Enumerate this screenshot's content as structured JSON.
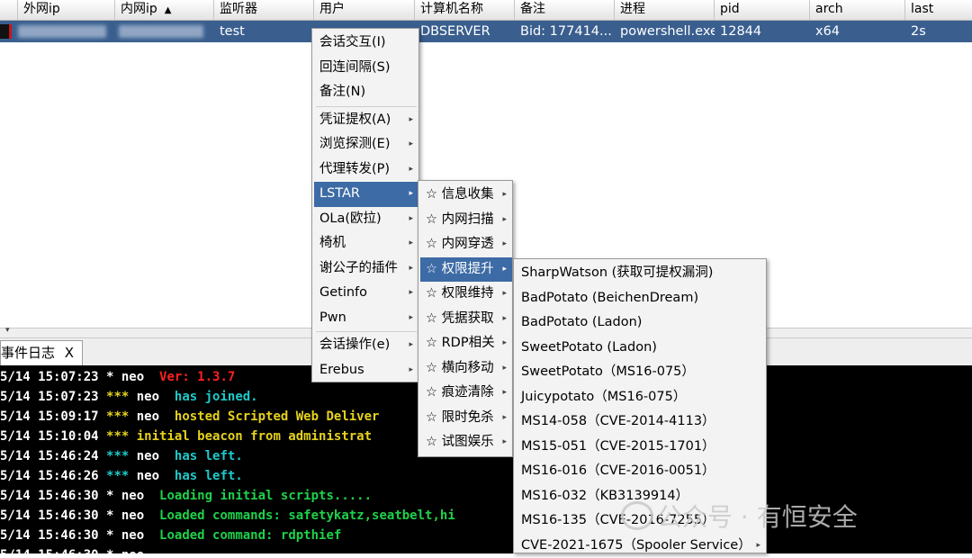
{
  "table": {
    "columns": [
      "外网ip",
      "内网ip",
      "监听器",
      "用户",
      "计算机名称",
      "备注",
      "进程",
      "pid",
      "arch",
      "last"
    ],
    "sort_indicator": "▲",
    "row": {
      "external_ip": "",
      "internal_ip": "",
      "listener": "test",
      "user": "",
      "computer": "DBSERVER",
      "note": "Bid: 177414...",
      "process": "powershell.exe",
      "pid": "12844",
      "arch": "x64",
      "last": "2s"
    }
  },
  "tab": {
    "label": "事件日志",
    "close": "X"
  },
  "console": {
    "lines": [
      {
        "ts": "5/14 15:07:23",
        "mark": "*",
        "user": "neo",
        "msg": "Ver: 1.3.7",
        "mark_color": "#ffffff",
        "msg_color": "#ff2020"
      },
      {
        "ts": "5/14 15:07:23",
        "mark": "***",
        "user": "neo",
        "msg": "has joined.",
        "mark_color": "#e6d21e",
        "msg_color": "#1fc9c9"
      },
      {
        "ts": "5/14 15:09:17",
        "mark": "***",
        "user": "neo",
        "msg": "hosted Scripted Web Deliver",
        "mark_color": "#e6d21e",
        "msg_color": "#e6d21e"
      },
      {
        "ts": "5/14 15:10:04",
        "mark": "***",
        "user": "",
        "msg": "initial beacon from administrat",
        "mark_color": "#e6d21e",
        "msg_color": "#e6d21e"
      },
      {
        "ts": "5/14 15:46:24",
        "mark": "***",
        "user": "neo",
        "msg": "has left.",
        "mark_color": "#1fc9c9",
        "msg_color": "#1fc9c9"
      },
      {
        "ts": "5/14 15:46:26",
        "mark": "***",
        "user": "neo",
        "msg": "has left.",
        "mark_color": "#1fc9c9",
        "msg_color": "#1fc9c9"
      },
      {
        "ts": "5/14 15:46:30",
        "mark": "*",
        "user": "neo",
        "msg": "Loading initial scripts.....",
        "mark_color": "#ffffff",
        "msg_color": "#1fd14a"
      },
      {
        "ts": "5/14 15:46:30",
        "mark": "*",
        "user": "neo",
        "msg": "Loaded commands: safetykatz,seatbelt,hi",
        "mark_color": "#ffffff",
        "msg_color": "#1fd14a"
      },
      {
        "ts": "5/14 15:46:30",
        "mark": "*",
        "user": "neo",
        "msg": "Loaded command: rdpthief",
        "mark_color": "#ffffff",
        "msg_color": "#1fd14a"
      },
      {
        "ts": "5/14 15:46:30",
        "mark": "*",
        "user": "neo",
        "msg": "",
        "mark_color": "#ffffff",
        "msg_color": "#1fd14a"
      }
    ]
  },
  "menu1": {
    "items": [
      {
        "label": "会话交互(I)",
        "sub": false
      },
      {
        "label": "回连间隔(S)",
        "sub": false
      },
      {
        "label": "备注(N)",
        "sub": false
      },
      {
        "label": "凭证提权(A)",
        "sub": true
      },
      {
        "label": "浏览探测(E)",
        "sub": true
      },
      {
        "label": "代理转发(P)",
        "sub": true
      },
      {
        "label": "LSTAR",
        "sub": true,
        "selected": true
      },
      {
        "label": "OLa(欧拉)",
        "sub": true
      },
      {
        "label": "椅机",
        "sub": true
      },
      {
        "label": "谢公子的插件",
        "sub": true
      },
      {
        "label": "Getinfo",
        "sub": true
      },
      {
        "label": "Pwn",
        "sub": true
      },
      {
        "label": "会话操作(e)",
        "sub": true
      },
      {
        "label": "Erebus",
        "sub": true
      }
    ]
  },
  "menu2": {
    "items": [
      {
        "label": "☆ 信息收集"
      },
      {
        "label": "☆ 内网扫描"
      },
      {
        "label": "☆ 内网穿透"
      },
      {
        "label": "☆ 权限提升",
        "selected": true
      },
      {
        "label": "☆ 权限维持"
      },
      {
        "label": "☆ 凭据获取"
      },
      {
        "label": "☆ RDP相关"
      },
      {
        "label": "☆ 横向移动"
      },
      {
        "label": "☆ 痕迹清除"
      },
      {
        "label": "☆ 限时免杀"
      },
      {
        "label": "☆ 试图娱乐"
      }
    ]
  },
  "menu3": {
    "items": [
      {
        "label": "SharpWatson (获取可提权漏洞)"
      },
      {
        "label": "BadPotato (BeichenDream)"
      },
      {
        "label": "BadPotato (Ladon)"
      },
      {
        "label": "SweetPotato (Ladon)"
      },
      {
        "label": "SweetPotato（MS16-075）"
      },
      {
        "label": "Juicypotato（MS16-075）"
      },
      {
        "label": "MS14-058（CVE-2014-4113）"
      },
      {
        "label": "MS15-051（CVE-2015-1701）"
      },
      {
        "label": "MS16-016（CVE-2016-0051）"
      },
      {
        "label": "MS16-032（KB3139914）"
      },
      {
        "label": "MS16-135（CVE-2016-7255）"
      },
      {
        "label": "CVE-2021-1675（Spooler Service）",
        "sub": true
      }
    ]
  },
  "watermark": "公众号 · 有恒安全",
  "arrow_glyph": "▸"
}
